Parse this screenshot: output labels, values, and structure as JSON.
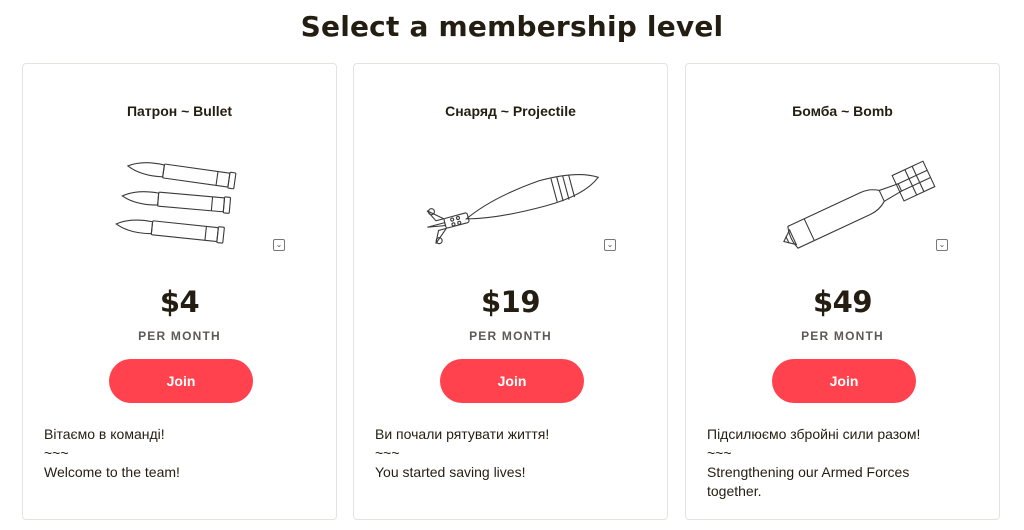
{
  "page": {
    "title": "Select a membership level"
  },
  "tiers": [
    {
      "name": "Патрон ~ Bullet",
      "icon": "bullets-illustration",
      "price": "$4",
      "period": "PER MONTH",
      "button_label": "Join",
      "desc_uk": "Вітаємо в команді!",
      "desc_sep": "~~~",
      "desc_en": "Welcome to the team!"
    },
    {
      "name": "Снаряд ~ Projectile",
      "icon": "mortar-shell-illustration",
      "price": "$19",
      "period": "PER MONTH",
      "button_label": "Join",
      "desc_uk": "Ви почали рятувати життя!",
      "desc_sep": "~~~",
      "desc_en": "You started saving lives!"
    },
    {
      "name": "Бомба ~ Bomb",
      "icon": "aerial-bomb-illustration",
      "price": "$49",
      "period": "PER MONTH",
      "button_label": "Join",
      "desc_uk": "Підсилюємо збройні сили разом!",
      "desc_sep": "~~~",
      "desc_en": "Strengthening our Armed Forces together."
    }
  ],
  "colors": {
    "accent": "#ff424d",
    "text": "#241e12",
    "muted": "#5c5a55",
    "border": "#e5e3dd"
  }
}
